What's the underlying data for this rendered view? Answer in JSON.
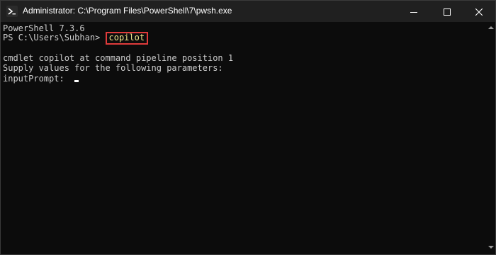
{
  "window": {
    "title": "Administrator: C:\\Program Files\\PowerShell\\7\\pwsh.exe",
    "icon": "powershell-icon",
    "controls": [
      "minimize-icon",
      "maximize-icon",
      "close-icon"
    ]
  },
  "console": {
    "version_line": "PowerShell 7.3.6",
    "prompt": "PS C:\\Users\\Subhan> ",
    "command": "copilot",
    "output_line_1": "cmdlet copilot at command pipeline position 1",
    "output_line_2": "Supply values for the following parameters:",
    "input_prompt": "inputPrompt: "
  },
  "colors": {
    "background": "#0c0c0c",
    "text": "#cccccc",
    "command": "#f0e68c",
    "highlight_border": "#e03b3b",
    "titlebar": "#202020"
  }
}
